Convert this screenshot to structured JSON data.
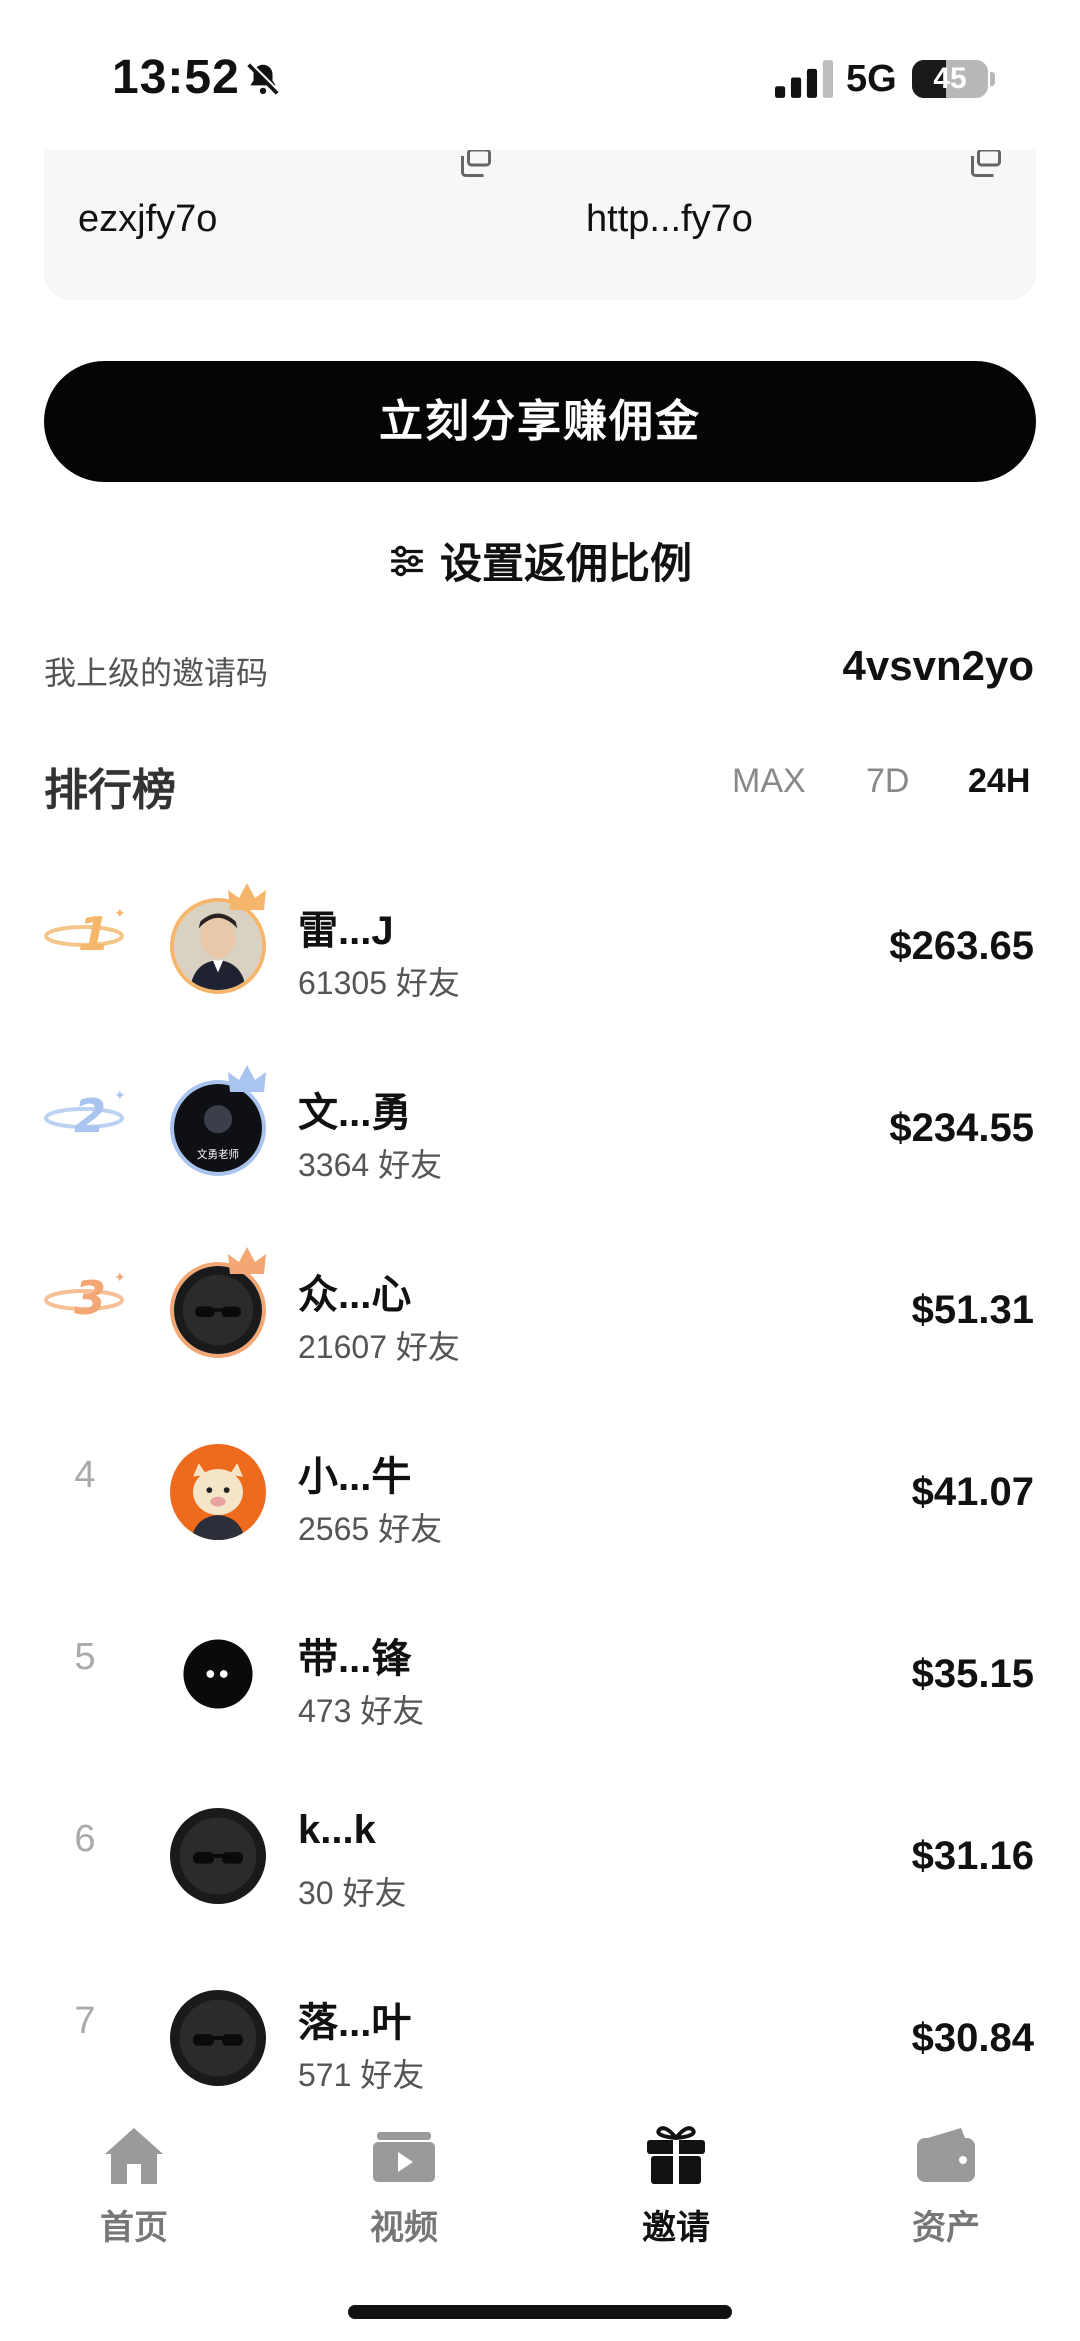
{
  "status_bar": {
    "time": "13:52",
    "network": "5G",
    "battery": "45",
    "battery_level": 0.45
  },
  "invite": {
    "code": "ezxjfy7o",
    "link": "http...fy7o"
  },
  "share_button": "立刻分享赚佣金",
  "ratio_label": "设置返佣比例",
  "inviter": {
    "label": "我上级的邀请码",
    "code": "4vsvn2yo"
  },
  "leaderboard": {
    "title": "排行榜",
    "tabs": [
      "MAX",
      "7D",
      "24H"
    ],
    "active_tab": "24H",
    "rows": [
      {
        "rank": "1",
        "name": "雷...J",
        "friends": "61305 好友",
        "amount": "$263.65"
      },
      {
        "rank": "2",
        "name": "文...勇",
        "friends": "3364 好友",
        "amount": "$234.55",
        "avatar_text": "文勇老师"
      },
      {
        "rank": "3",
        "name": "众...心",
        "friends": "21607 好友",
        "amount": "$51.31"
      },
      {
        "rank": "4",
        "name": "小...牛",
        "friends": "2565 好友",
        "amount": "$41.07"
      },
      {
        "rank": "5",
        "name": "带...锋",
        "friends": "473 好友",
        "amount": "$35.15"
      },
      {
        "rank": "6",
        "name": "k...k",
        "friends": "30 好友",
        "amount": "$31.16"
      },
      {
        "rank": "7",
        "name": "落...叶",
        "friends": "571 好友",
        "amount": "$30.84"
      }
    ]
  },
  "nav": [
    {
      "label": "首页",
      "icon": "home-icon"
    },
    {
      "label": "视频",
      "icon": "video-icon"
    },
    {
      "label": "邀请",
      "icon": "gift-icon",
      "active": true
    },
    {
      "label": "资产",
      "icon": "wallet-icon"
    }
  ],
  "colors": {
    "gold": "#f5b56a",
    "silver": "#a9c4ee",
    "bronze": "#f3a774",
    "accent": "#050505"
  }
}
